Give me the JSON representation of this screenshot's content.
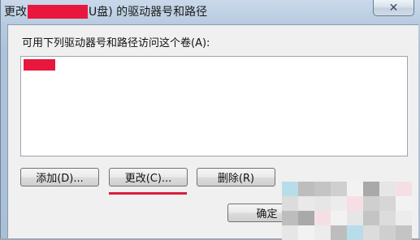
{
  "window": {
    "title_prefix": "更改",
    "title_suffix": "U盘) 的驱动器号和路径",
    "close_glyph": "✕"
  },
  "dialog": {
    "instruction": "可用下列驱动器号和路径访问这个卷(A):",
    "buttons": {
      "add": "添加(D)...",
      "change": "更改(C)...",
      "remove": "删除(R)",
      "ok": "确定"
    }
  },
  "colors": {
    "redaction": "#e8173d",
    "highlight_underline": "#d81e3f"
  }
}
